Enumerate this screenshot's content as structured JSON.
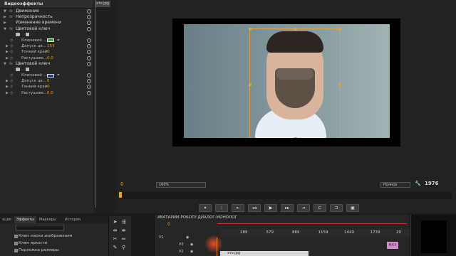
{
  "effect_controls": {
    "header": "Видеоэффекты",
    "clip_name": "это.jpg",
    "rows": [
      {
        "type": "effect",
        "label": "Движение",
        "fx": "fx",
        "expanded": true
      },
      {
        "type": "effect",
        "label": "Непрозрачность",
        "fx": "fx",
        "expanded": false
      },
      {
        "type": "effect",
        "label": "Изменение времени",
        "fx": "",
        "expanded": false
      },
      {
        "type": "effect",
        "label": "Цветовой ключ",
        "fx": "fx",
        "expanded": true
      },
      {
        "type": "tools"
      },
      {
        "type": "color",
        "label": "Ключевой ...",
        "color": "#18c018"
      },
      {
        "type": "param",
        "label": "Допуск цв...",
        "value": "153"
      },
      {
        "type": "param",
        "label": "Тонкий край",
        "value": "0"
      },
      {
        "type": "param",
        "label": "Растушевк...",
        "value": "0,0"
      },
      {
        "type": "effect",
        "label": "Цветовой ключ",
        "fx": "fx",
        "expanded": true
      },
      {
        "type": "tools"
      },
      {
        "type": "color",
        "label": "Ключевой ...",
        "color": "#1c2cc8"
      },
      {
        "type": "param",
        "label": "Допуск цв...",
        "value": "0"
      },
      {
        "type": "param",
        "label": "Тонкий край",
        "value": "0"
      },
      {
        "type": "param",
        "label": "Растушевк...",
        "value": "0,0"
      }
    ]
  },
  "program_monitor": {
    "timecode_left": "0",
    "zoom": "100%",
    "quality": "Полное",
    "timecode_right": "1976",
    "transport_buttons": [
      "mark-in-icon",
      "mark-out-icon",
      "go-to-in-icon",
      "step-back-icon",
      "play-icon",
      "step-forward-icon",
      "go-to-out-icon",
      "insert-icon",
      "overwrite-icon",
      "export-frame-icon"
    ]
  },
  "project_panel": {
    "tabs": [
      "ация",
      "Эффекты",
      "Маркеры",
      "История"
    ],
    "active_tab": 1,
    "items": [
      "Ключ маски изображения",
      "Ключ яркости",
      "Подложка размеры"
    ]
  },
  "timeline": {
    "title": "АВАТАРИМ РОБОТУ ДИАЛОГ-МОНОЛОГ",
    "timecode": "0",
    "ruler": [
      "289",
      "579",
      "869",
      "1159",
      "1449",
      "1739",
      "20"
    ],
    "tracks": [
      "V1",
      "V3",
      "V2"
    ],
    "clip_v3": "это.jpg",
    "clip_mx": "МХХ"
  }
}
